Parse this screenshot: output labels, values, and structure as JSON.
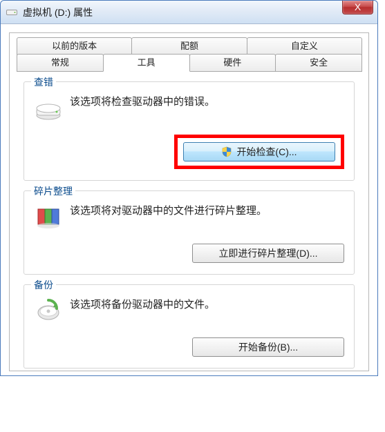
{
  "window": {
    "title": "虚拟机 (D:) 属性",
    "close": "X"
  },
  "tabs": {
    "row1": [
      "以前的版本",
      "配额",
      "自定义"
    ],
    "row2": [
      "常规",
      "工具",
      "硬件",
      "安全"
    ],
    "active": "工具"
  },
  "groups": {
    "check": {
      "legend": "查错",
      "desc": "该选项将检查驱动器中的错误。",
      "button": "开始检查(C)..."
    },
    "defrag": {
      "legend": "碎片整理",
      "desc": "该选项将对驱动器中的文件进行碎片整理。",
      "button": "立即进行碎片整理(D)..."
    },
    "backup": {
      "legend": "备份",
      "desc": "该选项将备份驱动器中的文件。",
      "button": "开始备份(B)..."
    }
  }
}
